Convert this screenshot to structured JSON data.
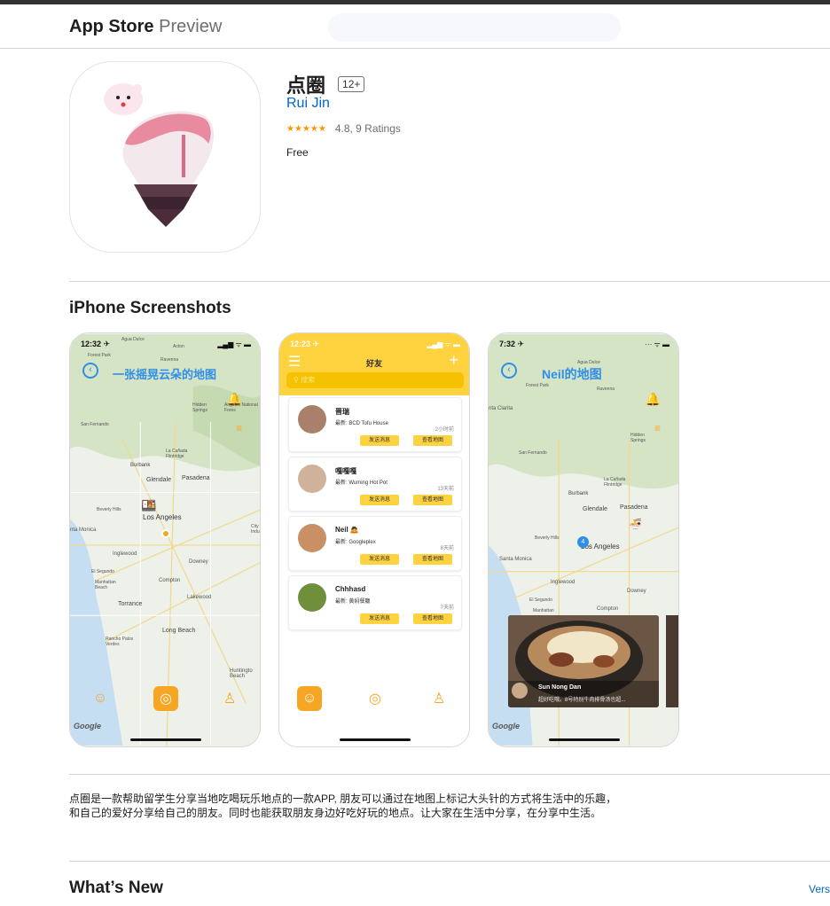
{
  "header": {
    "brand": "App Store",
    "suffix": "Preview"
  },
  "app": {
    "name": "点圈",
    "age_rating": "12+",
    "developer": "Rui Jin",
    "stars": "★★★★★",
    "rating_text": "4.8, 9 Ratings",
    "price": "Free"
  },
  "screenshots": {
    "title": "iPhone Screenshots",
    "shot1": {
      "time": "12:32 ✈",
      "title": "一张摇晃云朵的地图",
      "places": [
        "Agua Dulce",
        "Acton",
        "Forest Park",
        "Ravenna",
        "Hidden Springs",
        "Angeles National Fores",
        "San Fernando",
        "La Cañada Flintridge",
        "Burbank",
        "Glendale",
        "Pasadena",
        "Beverly Hills",
        "Los Angeles",
        "nta Monica",
        "Inglewood",
        "Downey",
        "El Segundo",
        "Manhattan Beach",
        "Compton",
        "Torrance",
        "Lakewood",
        "Long Beach",
        "Rancho Palos Verdes",
        "Huntingto Beach",
        "City Indu"
      ],
      "google": "Google"
    },
    "shot2": {
      "time": "12:23 ✈",
      "title": "好友",
      "search_placeholder": "搜索",
      "friends": [
        {
          "name": "晋瑞",
          "latest": "最新: BCD Tofu House",
          "time": "2小时前",
          "btn1": "发送消息",
          "btn2": "查看地图"
        },
        {
          "name": "嘎嘎嘎",
          "latest": "最新: Wuming Hot Pot",
          "time": "13天前",
          "btn1": "发送消息",
          "btn2": "查看地图"
        },
        {
          "name": "Neil",
          "latest": "最新: Googleplex",
          "time": "8天前",
          "btn1": "发送消息",
          "btn2": "查看地图"
        },
        {
          "name": "Chhhasd",
          "latest": "最新: 黄焖餐廳",
          "time": "7天前",
          "btn1": "发送消息",
          "btn2": "查看地图"
        }
      ]
    },
    "shot3": {
      "time": "7:32 ✈",
      "title": "Neil的地图",
      "places": [
        "Agua Dulce",
        "Forest Park",
        "Ravenna",
        "nta Clarita",
        "Hidden Springs",
        "San Fernando",
        "La Cañada Flintridge",
        "Burbank",
        "Glendale",
        "Pasadena",
        "Beverly Hills",
        "Los Angeles",
        "Santa Monica",
        "Inglewood",
        "Downey",
        "El Segundo",
        "Manhattan",
        "Compton"
      ],
      "cluster": "4",
      "photo_name": "Sun Nong Dan",
      "photo_caption": "超好吃哦。8号特别牛肉排骨汤也超...",
      "google": "Google"
    }
  },
  "description": "点圈是一款帮助留学生分享当地吃喝玩乐地点的一款APP, 朋友可以通过在地图上标记大头针的方式将生活中的乐趣，和自己的爱好分享给自己的朋友。同时也能获取朋友身边好吃好玩的地点。让大家在生活中分享，在分享中生活。",
  "whats_new": {
    "title": "What’s New",
    "link": "Vers"
  }
}
